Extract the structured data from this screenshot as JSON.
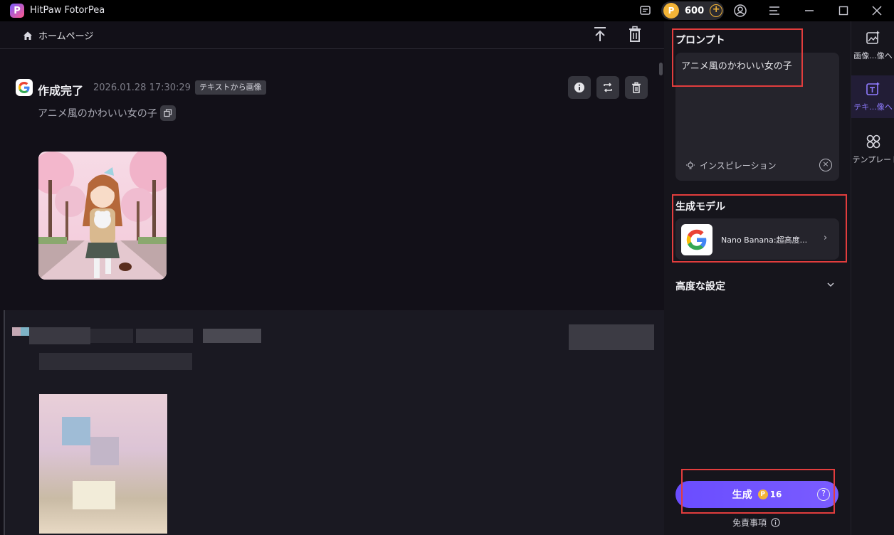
{
  "app": {
    "title": "HitPaw FotorPea",
    "logo_letter": "P"
  },
  "titlebar": {
    "coins": "600",
    "coin_symbol": "P",
    "plus": "+"
  },
  "header": {
    "home_label": "ホームページ"
  },
  "result": {
    "status": "作成完了",
    "datetime": "2026.01.28   17:30:29",
    "tag": "テキストから画像",
    "prompt": "アニメ風のかわいい女の子"
  },
  "panel": {
    "prompt_title": "プロンプト",
    "prompt_value": "アニメ風のかわいい女の子",
    "inspiration_label": "インスピレーション",
    "model_title": "生成モデル",
    "model_name": "Nano Banana:超高度...",
    "advanced_title": "高度な設定",
    "generate_label": "生成",
    "generate_cost": "16",
    "disclaimer": "免責事項"
  },
  "side_nav": {
    "items": [
      {
        "label": "画像...像へ",
        "icon": "image-edit-icon"
      },
      {
        "label": "テキ...像へ",
        "icon": "text-to-image-icon"
      },
      {
        "label": "テンプレート",
        "icon": "template-icon"
      }
    ]
  },
  "colors": {
    "accent": "#6a4dff",
    "highlight": "#e23d3d",
    "coin": "#f3b437"
  }
}
